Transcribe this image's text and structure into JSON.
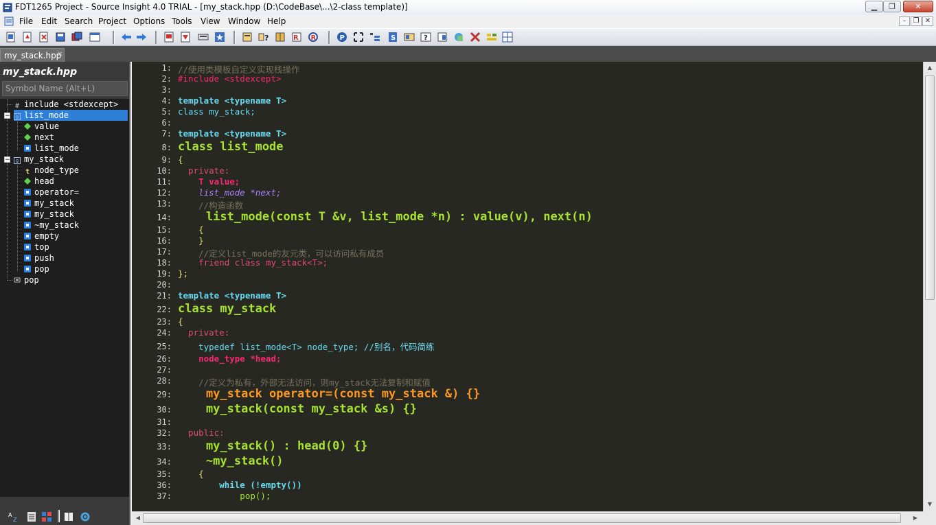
{
  "window": {
    "title": "FDT1265 Project - Source Insight 4.0 TRIAL - [my_stack.hpp (D:\\CodeBase\\...\\2-class template)]",
    "controls": {
      "minimize": "▁",
      "maximize": "❐",
      "close": "✕"
    }
  },
  "menubar": {
    "items": [
      "File",
      "Edit",
      "Search",
      "Project",
      "Options",
      "Tools",
      "View",
      "Window",
      "Help"
    ],
    "mdi_controls": {
      "minimize": "–",
      "restore": "❐",
      "close": "✕"
    }
  },
  "tabs": [
    {
      "label": "my_stack.hpp",
      "close": "✕"
    }
  ],
  "symbol_panel": {
    "file_name": "my_stack.hpp",
    "search_placeholder": "Symbol Name (Alt+L)",
    "symbols": [
      {
        "label": "include <stdexcept>",
        "icon": "hash-icon",
        "depth": 0
      },
      {
        "label": "list_mode",
        "icon": "class-icon",
        "depth": 0,
        "expanded": true,
        "selected": true
      },
      {
        "label": "value",
        "icon": "member-diamond-icon",
        "depth": 1
      },
      {
        "label": "next",
        "icon": "member-diamond-icon",
        "depth": 1
      },
      {
        "label": "list_mode",
        "icon": "method-icon",
        "depth": 1
      },
      {
        "label": "my_stack",
        "icon": "class-icon",
        "depth": 0,
        "expanded": true
      },
      {
        "label": "node_type",
        "icon": "typedef-icon",
        "depth": 1
      },
      {
        "label": "head",
        "icon": "member-diamond-icon",
        "depth": 1
      },
      {
        "label": "operator=",
        "icon": "method-icon",
        "depth": 1
      },
      {
        "label": "my_stack",
        "icon": "method-icon",
        "depth": 1
      },
      {
        "label": "my_stack",
        "icon": "method-icon",
        "depth": 1
      },
      {
        "label": "~my_stack",
        "icon": "method-icon",
        "depth": 1
      },
      {
        "label": "empty",
        "icon": "method-icon",
        "depth": 1
      },
      {
        "label": "top",
        "icon": "method-icon",
        "depth": 1
      },
      {
        "label": "push",
        "icon": "method-icon",
        "depth": 1
      },
      {
        "label": "pop",
        "icon": "method-icon",
        "depth": 1
      },
      {
        "label": "pop",
        "icon": "function-icon",
        "depth": 0
      }
    ]
  },
  "editor": {
    "line_numbers": [
      "1:",
      "2:",
      "3:",
      "4:",
      "5:",
      "6:",
      "7:",
      "8:",
      "9:",
      "10:",
      "11:",
      "12:",
      "13:",
      "14:",
      "15:",
      "16:",
      "17:",
      "18:",
      "19:",
      "20:",
      "21:",
      "22:",
      "23:",
      "24:",
      "25:",
      "26:",
      "27:",
      "28:",
      "29:",
      "30:",
      "31:",
      "32:",
      "33:",
      "34:",
      "35:",
      "36:",
      "37:"
    ],
    "code_lines": [
      "//使用类模板自定义实现栈操作",
      "#include <stdexcept>",
      "",
      "template <typename T>",
      "class my_stack;",
      "",
      "template <typename T>",
      "class list_mode",
      "{",
      "  private:",
      "    T value;",
      "    list_mode *next;",
      "    //构造函数",
      "    list_mode(const T &v, list_mode *n) : value(v), next(n)",
      "    {",
      "    }",
      "    //定义list_mode的友元类，可以访问私有成员",
      "    friend class my_stack<T>;",
      "};",
      "",
      "template <typename T>",
      "class my_stack",
      "{",
      "  private:",
      "    typedef list_mode<T> node_type; //别名，代码简练",
      "    node_type *head;",
      "",
      "    //定义为私有，外部无法访问，则my_stack无法复制和赋值",
      "    my_stack operator=(const my_stack &) {}",
      "    my_stack(const my_stack &s) {}",
      "",
      "  public:",
      "    my_stack() : head(0) {}",
      "    ~my_stack()",
      "    {",
      "        while (!empty())",
      "            pop();"
    ]
  },
  "colors": {
    "editor_bg": "#272822",
    "panel_bg": "#1e1e1e",
    "selection": "#2e7fd8",
    "keyword": "#66d9ef",
    "class_name": "#a6e22e",
    "comment": "#75715e",
    "preprocessor": "#f92672",
    "member": "#fd971f"
  }
}
